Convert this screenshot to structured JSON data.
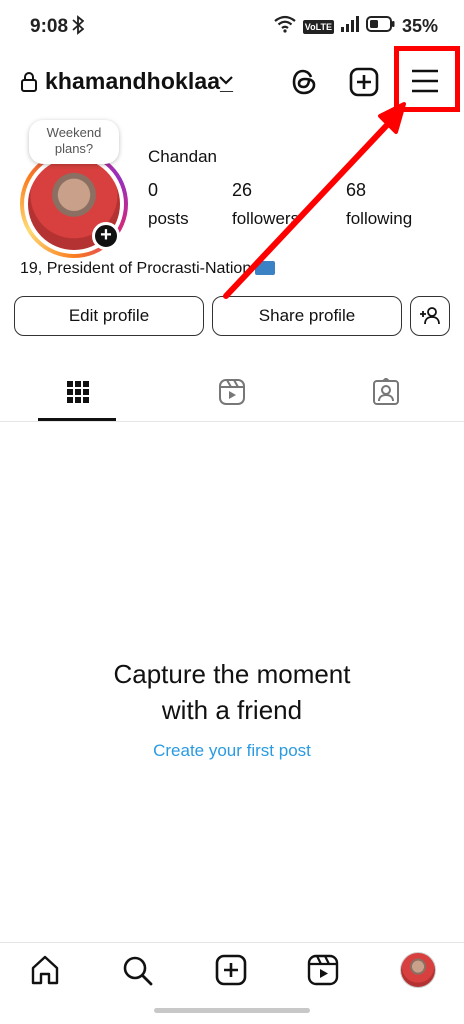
{
  "status_bar": {
    "time": "9:08",
    "volte": "VoLTE",
    "battery": "35%"
  },
  "header": {
    "username": "khamandhoklaa_"
  },
  "note": {
    "text": "Weekend plans?"
  },
  "profile": {
    "display_name": "Chandan",
    "stats": [
      {
        "value": "0",
        "label": "posts"
      },
      {
        "value": "26",
        "label": "followers"
      },
      {
        "value": "68",
        "label": "following"
      }
    ],
    "bio": "19, President of Procrasti-Nation"
  },
  "buttons": {
    "edit": "Edit profile",
    "share": "Share profile"
  },
  "tabs": [
    "grid-icon",
    "reels-icon",
    "tagged-icon"
  ],
  "empty_state": {
    "title_line1": "Capture the moment",
    "title_line2": "with a friend",
    "link": "Create your first post"
  },
  "colors": {
    "highlight": "#ff0000",
    "link": "#2a9be0"
  }
}
